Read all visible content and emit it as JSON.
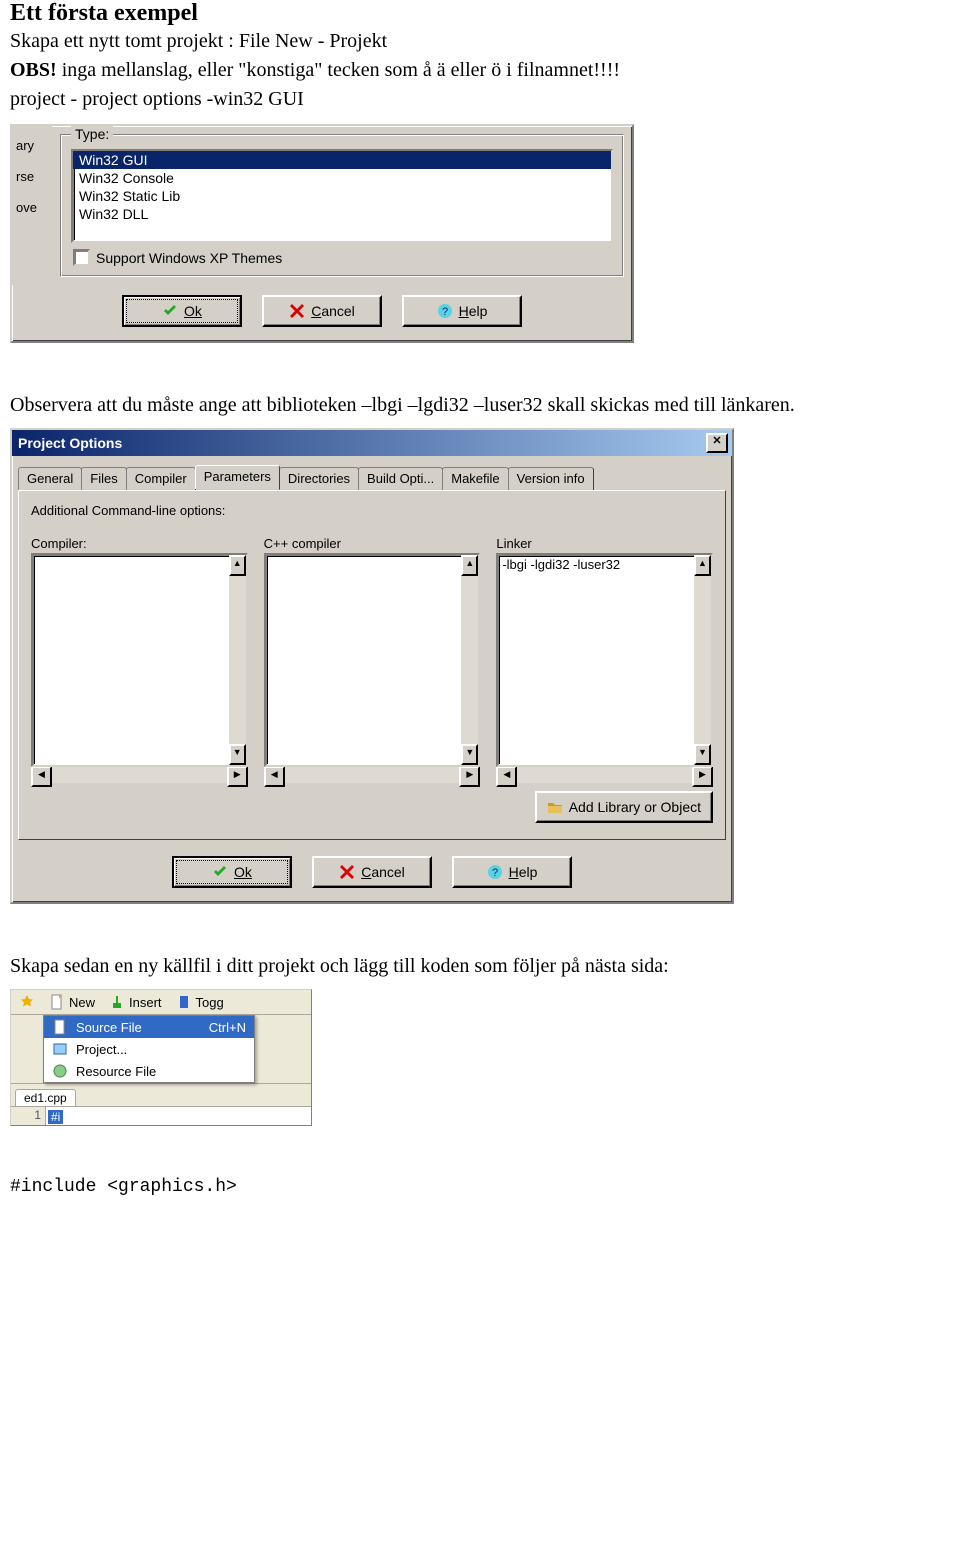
{
  "doc": {
    "heading": "Ett första exempel",
    "p1": "Skapa ett nytt tomt projekt : File New - Projekt",
    "p2a": "OBS!",
    "p2b": " inga mellanslag, eller \"konstiga\" tecken som å ä eller ö i filnamnet!!!!",
    "p3": "project - project options -win32 GUI",
    "p_obs": "Observera att du måste ange att biblioteken –lbgi –lgdi32 –luser32  skall skickas med till länkaren.",
    "p_skapa": "Skapa sedan en ny källfil i ditt projekt och lägg till koden som följer på nästa sida:",
    "code": "#include <graphics.h>"
  },
  "dlg1": {
    "side_labels": [
      "ary",
      "rse",
      "ove"
    ],
    "group_legend": "Type:",
    "list_items": [
      "Win32 GUI",
      "Win32 Console",
      "Win32 Static Lib",
      "Win32 DLL"
    ],
    "list_selected_index": 0,
    "checkbox_label": "Support Windows XP Themes",
    "buttons": {
      "ok": "Ok",
      "cancel": "Cancel",
      "help": "Help"
    }
  },
  "dlg2": {
    "title": "Project Options",
    "tabs": [
      "General",
      "Files",
      "Compiler",
      "Parameters",
      "Directories",
      "Build Opti...",
      "Makefile",
      "Version info"
    ],
    "active_tab_index": 3,
    "panel_label": "Additional Command-line options:",
    "cols": {
      "compiler": "Compiler:",
      "cpp": "C++ compiler",
      "linker": "Linker"
    },
    "linker_value": "-lbgi -lgdi32 -luser32",
    "add_lib_label": "Add Library or Object",
    "buttons": {
      "ok": "Ok",
      "cancel": "Cancel",
      "help": "Help"
    }
  },
  "shot3": {
    "toolbar": {
      "new": "New",
      "insert": "Insert",
      "togg": "Togg"
    },
    "menu": {
      "source": {
        "label": "Source File",
        "shortcut": "Ctrl+N"
      },
      "project": "Project...",
      "resource": "Resource File"
    },
    "file_tab": "ed1.cpp",
    "line_no": "1",
    "code_sel": "#i"
  }
}
